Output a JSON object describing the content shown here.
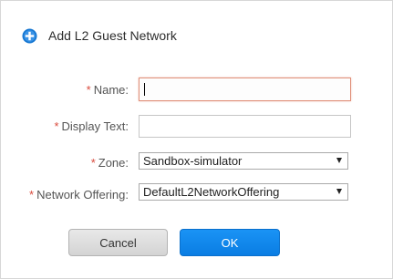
{
  "dialog": {
    "title": "Add L2 Guest Network",
    "icon": "add-circle-icon"
  },
  "form": {
    "required_mark": "*",
    "fields": [
      {
        "label": "Name:",
        "value": "",
        "required": true,
        "focused": true
      },
      {
        "label": "Display Text:",
        "value": "",
        "required": true
      },
      {
        "label": "Zone:",
        "value": "Sandbox-simulator",
        "required": true
      },
      {
        "label": "Network Offering:",
        "value": "DefaultL2NetworkOffering",
        "required": true
      }
    ]
  },
  "buttons": {
    "cancel": "Cancel",
    "ok": "OK"
  },
  "colors": {
    "ok_button": "#0a7de3",
    "required_mark": "#d94a3c",
    "focus_border": "#e08f79",
    "icon_blue": "#1677d2"
  }
}
